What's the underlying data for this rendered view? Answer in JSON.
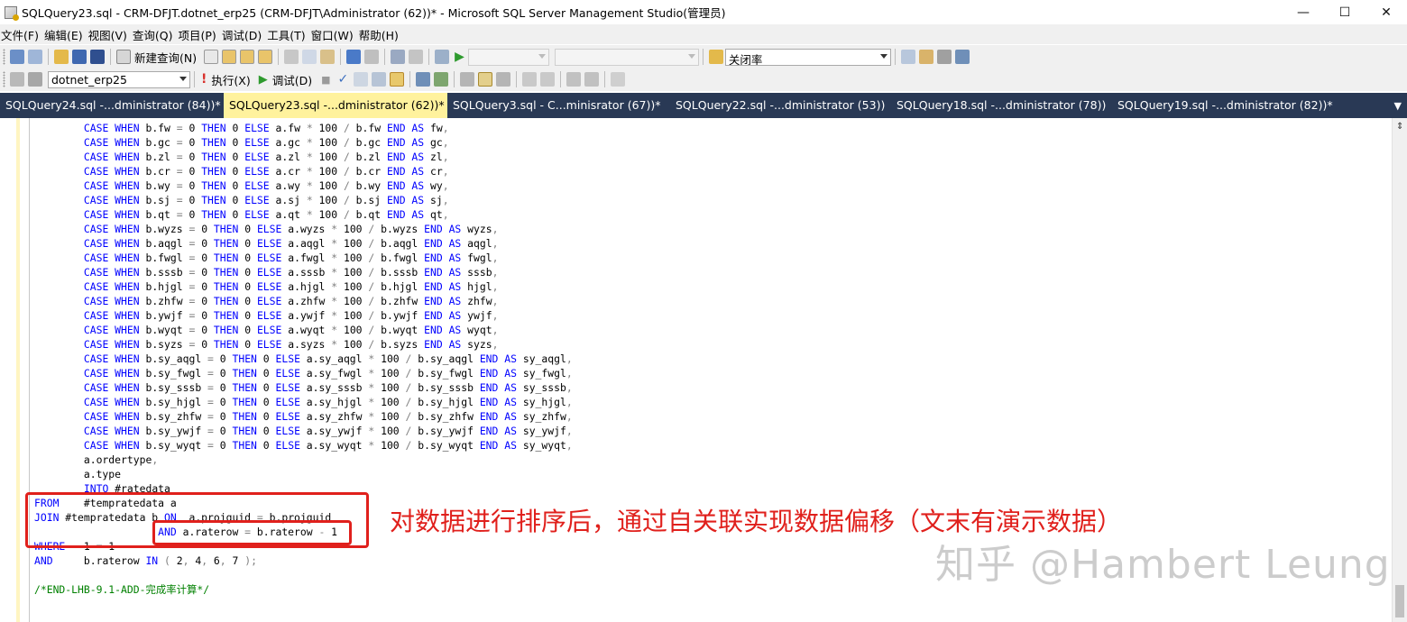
{
  "window": {
    "title": "SQLQuery23.sql - CRM-DFJT.dotnet_erp25 (CRM-DFJT\\Administrator (62))* - Microsoft SQL Server Management Studio(管理员)",
    "minimize": "—",
    "maximize": "☐",
    "close": "✕"
  },
  "menu": [
    "文件(F)",
    "编辑(E)",
    "视图(V)",
    "查询(Q)",
    "项目(P)",
    "调试(D)",
    "工具(T)",
    "窗口(W)",
    "帮助(H)"
  ],
  "toolbar1": {
    "new_query_label": "新建查询(N)",
    "find_combo_value": "关闭率"
  },
  "toolbar2": {
    "database_combo_value": "dotnet_erp25",
    "execute_label": "执行(X)",
    "debug_label": "调试(D)"
  },
  "tabs": [
    {
      "label": "SQLQuery24.sql -...dministrator (84))*",
      "active": false
    },
    {
      "label": "SQLQuery23.sql -...dministrator (62))*",
      "active": true
    },
    {
      "label": "SQLQuery3.sql - C...minisrator (67))*",
      "active": false
    },
    {
      "label": "SQLQuery22.sql -...dministrator (53))",
      "active": false
    },
    {
      "label": "SQLQuery18.sql -...dministrator (78))",
      "active": false
    },
    {
      "label": "SQLQuery19.sql -...dministrator (82))*",
      "active": false
    }
  ],
  "code_lines": [
    "        CASE WHEN b.fw = 0 THEN 0 ELSE a.fw * 100 / b.fw END AS fw,",
    "        CASE WHEN b.gc = 0 THEN 0 ELSE a.gc * 100 / b.gc END AS gc,",
    "        CASE WHEN b.zl = 0 THEN 0 ELSE a.zl * 100 / b.zl END AS zl,",
    "        CASE WHEN b.cr = 0 THEN 0 ELSE a.cr * 100 / b.cr END AS cr,",
    "        CASE WHEN b.wy = 0 THEN 0 ELSE a.wy * 100 / b.wy END AS wy,",
    "        CASE WHEN b.sj = 0 THEN 0 ELSE a.sj * 100 / b.sj END AS sj,",
    "        CASE WHEN b.qt = 0 THEN 0 ELSE a.qt * 100 / b.qt END AS qt,",
    "        CASE WHEN b.wyzs = 0 THEN 0 ELSE a.wyzs * 100 / b.wyzs END AS wyzs,",
    "        CASE WHEN b.aqgl = 0 THEN 0 ELSE a.aqgl * 100 / b.aqgl END AS aqgl,",
    "        CASE WHEN b.fwgl = 0 THEN 0 ELSE a.fwgl * 100 / b.fwgl END AS fwgl,",
    "        CASE WHEN b.sssb = 0 THEN 0 ELSE a.sssb * 100 / b.sssb END AS sssb,",
    "        CASE WHEN b.hjgl = 0 THEN 0 ELSE a.hjgl * 100 / b.hjgl END AS hjgl,",
    "        CASE WHEN b.zhfw = 0 THEN 0 ELSE a.zhfw * 100 / b.zhfw END AS zhfw,",
    "        CASE WHEN b.ywjf = 0 THEN 0 ELSE a.ywjf * 100 / b.ywjf END AS ywjf,",
    "        CASE WHEN b.wyqt = 0 THEN 0 ELSE a.wyqt * 100 / b.wyqt END AS wyqt,",
    "        CASE WHEN b.syzs = 0 THEN 0 ELSE a.syzs * 100 / b.syzs END AS syzs,",
    "        CASE WHEN b.sy_aqgl = 0 THEN 0 ELSE a.sy_aqgl * 100 / b.sy_aqgl END AS sy_aqgl,",
    "        CASE WHEN b.sy_fwgl = 0 THEN 0 ELSE a.sy_fwgl * 100 / b.sy_fwgl END AS sy_fwgl,",
    "        CASE WHEN b.sy_sssb = 0 THEN 0 ELSE a.sy_sssb * 100 / b.sy_sssb END AS sy_sssb,",
    "        CASE WHEN b.sy_hjgl = 0 THEN 0 ELSE a.sy_hjgl * 100 / b.sy_hjgl END AS sy_hjgl,",
    "        CASE WHEN b.sy_zhfw = 0 THEN 0 ELSE a.sy_zhfw * 100 / b.sy_zhfw END AS sy_zhfw,",
    "        CASE WHEN b.sy_ywjf = 0 THEN 0 ELSE a.sy_ywjf * 100 / b.sy_ywjf END AS sy_ywjf,",
    "        CASE WHEN b.sy_wyqt = 0 THEN 0 ELSE a.sy_wyqt * 100 / b.sy_wyqt END AS sy_wyqt,",
    "        a.ordertype,",
    "        a.type",
    "        INTO #ratedata",
    "FROM    #tempratedata a",
    "JOIN #tempratedata b ON  a.projguid = b.projguid",
    "                    AND a.raterow = b.raterow - 1",
    "WHERE   1 = 1",
    "AND     b.raterow IN ( 2, 4, 6, 7 );",
    "",
    "/*END-LHB-9.1-ADD-完成率计算*/"
  ],
  "annotation_text": "对数据进行排序后，通过自关联实现数据偏移（文末有演示数据）",
  "watermark": "知乎 @Hambert Leung",
  "colors": {
    "keyword": "#0000ff",
    "operator": "#808080",
    "comment": "#008000",
    "tab_strip": "#293955",
    "active_tab": "#fff29d",
    "annotation_red": "#e0201c"
  }
}
